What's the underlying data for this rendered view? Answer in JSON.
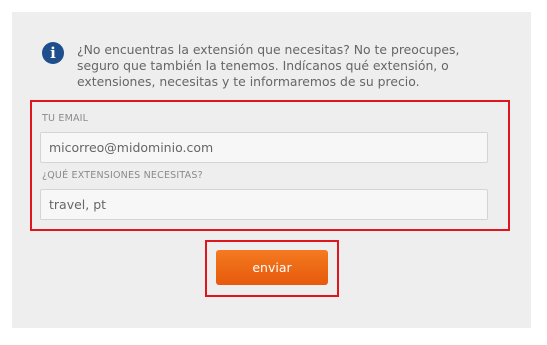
{
  "info": {
    "icon": "info-circle-icon",
    "text": "¿No encuentras la extensión que necesitas? No te preocupes, seguro que también la tenemos. Indícanos qué extensión, o extensiones, necesitas y te informaremos de su precio."
  },
  "form": {
    "email_label": "TU EMAIL",
    "email_value": "micorreo@midominio.com",
    "extensions_label": "¿QUÉ EXTENSIONES NECESITAS?",
    "extensions_value": "travel, pt"
  },
  "submit": {
    "label": "enviar"
  },
  "colors": {
    "panel_bg": "#eeeeee",
    "info_icon": "#1f4e8c",
    "highlight_border": "#e0161e",
    "button": "#f0701a"
  }
}
